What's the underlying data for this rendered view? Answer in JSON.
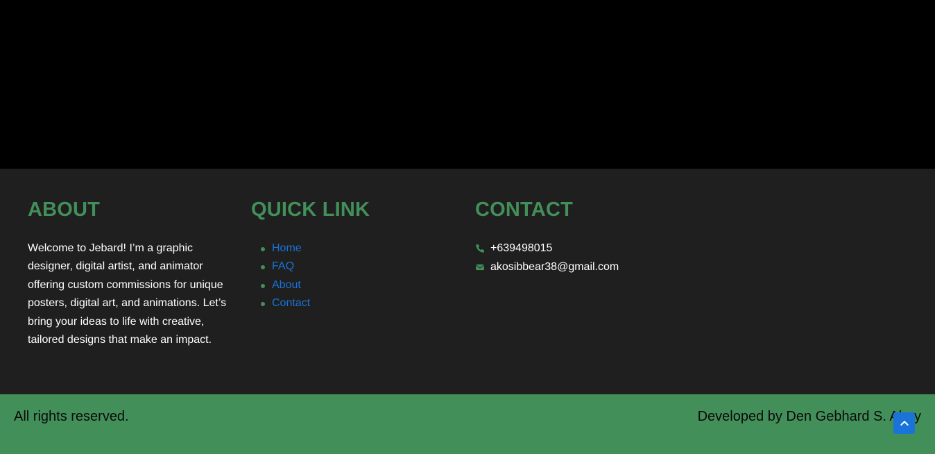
{
  "about": {
    "heading": "ABOUT",
    "text": "Welcome to Jebard! I’m a graphic designer, digital artist, and animator offering custom commissions for unique posters, digital art, and animations. Let’s bring your ideas to life with creative, tailored designs that make an impact."
  },
  "quick_links": {
    "heading": "QUICK LINK",
    "items": [
      {
        "label": "Home"
      },
      {
        "label": "FAQ"
      },
      {
        "label": "About"
      },
      {
        "label": "Contact"
      }
    ]
  },
  "contact": {
    "heading": "CONTACT",
    "phone": "+639498015",
    "email": "akosibbear38@gmail.com",
    "phone_icon": "phone-icon",
    "email_icon": "envelope-icon"
  },
  "bottom_bar": {
    "left_text": "All rights reserved.",
    "right_text": "Developed by Den Gebhard S. Abay"
  },
  "scroll_top": {
    "icon": "chevron-up-icon"
  },
  "colors": {
    "accent_green": "#438f59",
    "link_blue": "#1a73d9",
    "footer_bg": "#1f1f1f",
    "hero_bg": "#000000"
  }
}
